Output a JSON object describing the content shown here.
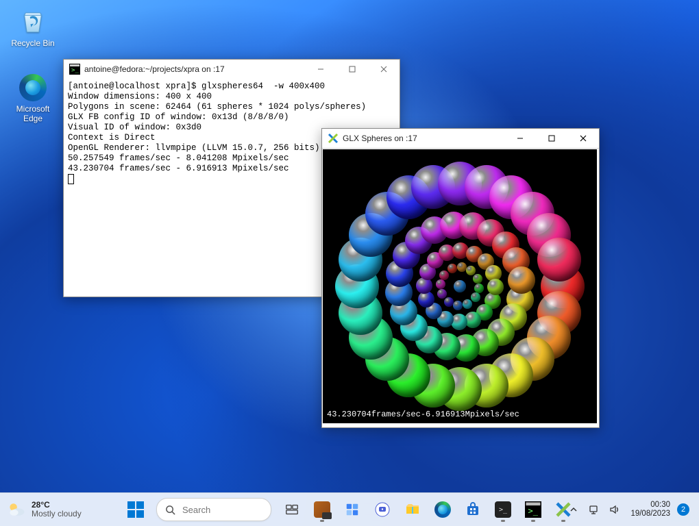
{
  "desktop_icons": {
    "recycle_bin": "Recycle Bin",
    "edge": "Microsoft Edge"
  },
  "terminal": {
    "title": "antoine@fedora:~/projects/xpra on :17",
    "lines": [
      "[antoine@localhost xpra]$ glxspheres64  -w 400x400",
      "Window dimensions: 400 x 400",
      "Polygons in scene: 62464 (61 spheres * 1024 polys/spheres)",
      "GLX FB config ID of window: 0x13d (8/8/8/0)",
      "Visual ID of window: 0x3d0",
      "Context is Direct",
      "OpenGL Renderer: llvmpipe (LLVM 15.0.7, 256 bits)",
      "50.257549 frames/sec - 8.041208 Mpixels/sec",
      "43.230704 frames/sec - 6.916913 Mpixels/sec"
    ]
  },
  "glx": {
    "title": "GLX Spheres on :17",
    "overlay": "43.230704frames/sec-6.916913Mpixels/sec",
    "rings": [
      {
        "count": 24,
        "radius": 150,
        "size": 64
      },
      {
        "count": 20,
        "radius": 90,
        "size": 40
      },
      {
        "count": 16,
        "radius": 52,
        "size": 24
      },
      {
        "count": 12,
        "radius": 28,
        "size": 14
      },
      {
        "count": 1,
        "radius": 0,
        "size": 18
      }
    ]
  },
  "taskbar": {
    "weather_temp": "28°C",
    "weather_desc": "Mostly cloudy",
    "search_placeholder": "Search",
    "time": "00:30",
    "date": "19/08/2023",
    "notif_count": "2"
  }
}
